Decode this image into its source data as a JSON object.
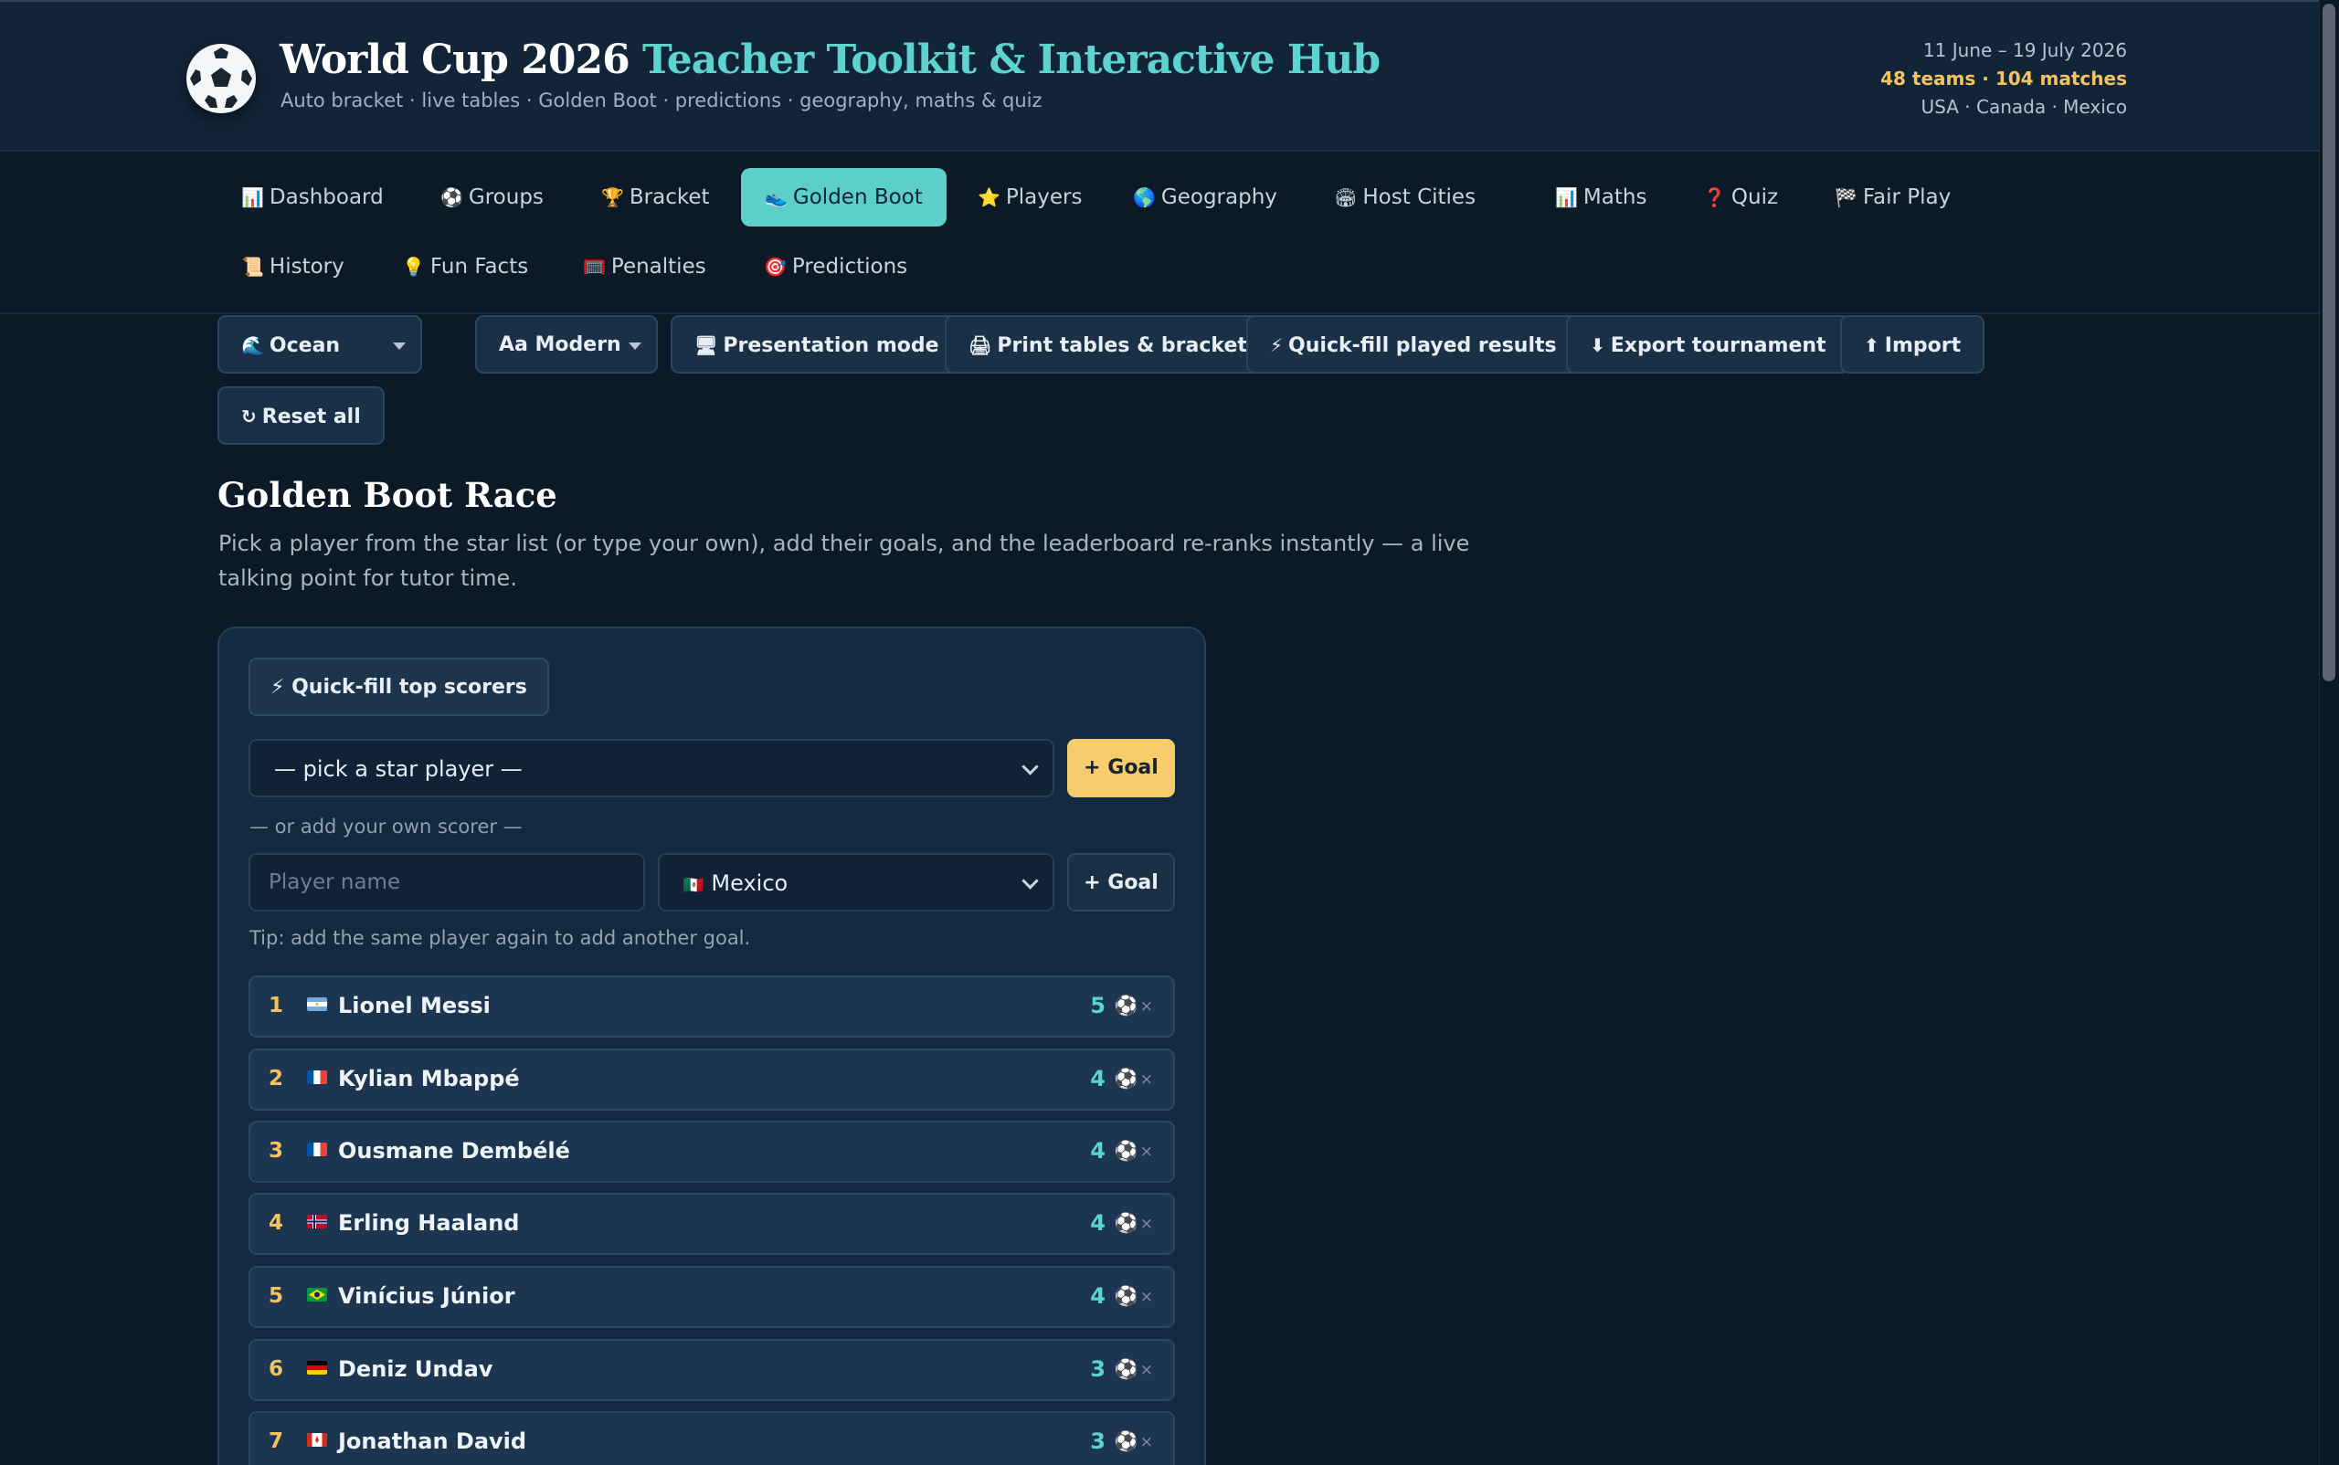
{
  "header": {
    "title_main": "World Cup 2026 ",
    "title_accent": "Teacher Toolkit & Interactive Hub",
    "subtitle": "Auto bracket · live tables · Golden Boot · predictions · geography, maths & quiz",
    "dates": "11 June – 19 July 2026",
    "stats": "48 teams · 104 matches",
    "hosts": "USA · Canada · Mexico"
  },
  "nav": {
    "tabs": [
      {
        "icon": "📊",
        "label": "Dashboard",
        "active": false
      },
      {
        "icon": "⚽",
        "label": "Groups",
        "active": false
      },
      {
        "icon": "🏆",
        "label": "Bracket",
        "active": false
      },
      {
        "icon": "👟",
        "label": "Golden Boot",
        "active": true
      },
      {
        "icon": "⭐",
        "label": "Players",
        "active": false
      },
      {
        "icon": "🌎",
        "label": "Geography",
        "active": false
      },
      {
        "icon": "🏟",
        "label": "Host Cities",
        "active": false
      },
      {
        "icon": "📊",
        "label": "Maths",
        "active": false
      },
      {
        "icon": "❓",
        "label": "Quiz",
        "active": false
      },
      {
        "icon": "🏁",
        "label": "Fair Play",
        "active": false
      },
      {
        "icon": "📜",
        "label": "History",
        "active": false
      },
      {
        "icon": "💡",
        "label": "Fun Facts",
        "active": false
      },
      {
        "icon": "🥅",
        "label": "Penalties",
        "active": false
      },
      {
        "icon": "🎯",
        "label": "Predictions",
        "active": false
      }
    ]
  },
  "toolbar": {
    "theme": {
      "icon": "🌊",
      "label": "Ocean"
    },
    "font": {
      "label": "Aa Modern"
    },
    "presentation": {
      "icon": "🖥",
      "label": "Presentation mode"
    },
    "print": {
      "icon": "🖨",
      "label": "Print tables & bracket"
    },
    "quickfill": {
      "icon": "⚡",
      "label": "Quick-fill played results"
    },
    "export": {
      "icon": "⬇",
      "label": "Export tournament"
    },
    "import": {
      "icon": "⬆",
      "label": "Import"
    },
    "reset": {
      "icon": "↻",
      "label": "Reset all"
    }
  },
  "section": {
    "title": "Golden Boot Race",
    "description": "Pick a player from the star list (or type your own), add their goals, and the leaderboard re-ranks instantly — a live talking point for tutor time."
  },
  "form": {
    "quickfill_label": "⚡ Quick-fill top scorers",
    "star_select_value": "— pick a star player —",
    "goal_label": "+ Goal",
    "or_label": "— or add your own scorer —",
    "name_placeholder": "Player name",
    "country_flag": "🇲🇽",
    "country_value": "Mexico",
    "goal_label_2": "+ Goal",
    "tip": "Tip: add the same player again to add another goal."
  },
  "leaderboard": [
    {
      "rank": "1",
      "name": "Lionel Messi",
      "goals": "5",
      "flag": "argentina"
    },
    {
      "rank": "2",
      "name": "Kylian Mbappé",
      "goals": "4",
      "flag": "france"
    },
    {
      "rank": "3",
      "name": "Ousmane Dembélé",
      "goals": "4",
      "flag": "france"
    },
    {
      "rank": "4",
      "name": "Erling Haaland",
      "goals": "4",
      "flag": "norway"
    },
    {
      "rank": "5",
      "name": "Vinícius Júnior",
      "goals": "4",
      "flag": "brazil"
    },
    {
      "rank": "6",
      "name": "Deniz Undav",
      "goals": "3",
      "flag": "germany"
    },
    {
      "rank": "7",
      "name": "Jonathan David",
      "goals": "3",
      "flag": "canada"
    }
  ],
  "colors": {
    "accent": "#5dd3cf",
    "gold": "#f4c25e",
    "background": "#0c1a28"
  }
}
